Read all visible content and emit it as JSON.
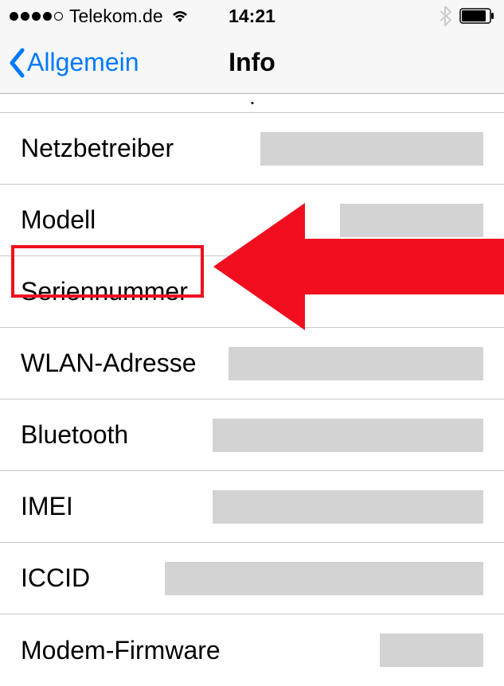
{
  "status": {
    "carrier": "Telekom.de",
    "time": "14:21"
  },
  "nav": {
    "back_label": "Allgemein",
    "title": "Info"
  },
  "rows": {
    "netzbetreiber": {
      "label": "Netzbetreiber"
    },
    "modell": {
      "label": "Modell"
    },
    "seriennummer": {
      "label": "Seriennummer"
    },
    "wlan": {
      "label": "WLAN-Adresse"
    },
    "bluetooth": {
      "label": "Bluetooth"
    },
    "imei": {
      "label": "IMEI"
    },
    "iccid": {
      "label": "ICCID"
    },
    "modem": {
      "label": "Modem-Firmware"
    }
  }
}
